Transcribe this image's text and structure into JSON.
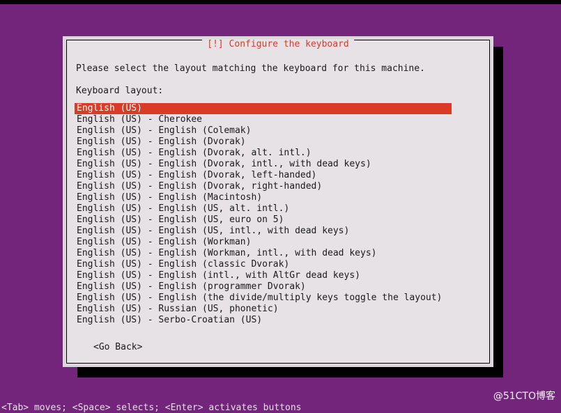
{
  "colors": {
    "desktop_background": "#72257a",
    "dialog_background": "#e6e2e6",
    "dialog_frame": "#ddd7dd",
    "title_accent": "#d93b26",
    "selection_background": "#d93b26",
    "selection_text": "#ffffff",
    "text": "#1a1a1a",
    "shadow": "#000000"
  },
  "dialog": {
    "title": "[!] Configure the keyboard",
    "prompt": "Please select the layout matching the keyboard for this machine.",
    "field_label": "Keyboard layout:",
    "selected_index": 0,
    "items": [
      "English (US)",
      "English (US) - Cherokee",
      "English (US) - English (Colemak)",
      "English (US) - English (Dvorak)",
      "English (US) - English (Dvorak, alt. intl.)",
      "English (US) - English (Dvorak, intl., with dead keys)",
      "English (US) - English (Dvorak, left-handed)",
      "English (US) - English (Dvorak, right-handed)",
      "English (US) - English (Macintosh)",
      "English (US) - English (US, alt. intl.)",
      "English (US) - English (US, euro on 5)",
      "English (US) - English (US, intl., with dead keys)",
      "English (US) - English (Workman)",
      "English (US) - English (Workman, intl., with dead keys)",
      "English (US) - English (classic Dvorak)",
      "English (US) - English (intl., with AltGr dead keys)",
      "English (US) - English (programmer Dvorak)",
      "English (US) - English (the divide/multiply keys toggle the layout)",
      "English (US) - Russian (US, phonetic)",
      "English (US) - Serbo-Croatian (US)"
    ],
    "go_back_label": "<Go Back>"
  },
  "statusbar": {
    "help_text": "<Tab> moves; <Space> selects; <Enter> activates buttons"
  },
  "watermark": {
    "text": "@51CTO博客"
  }
}
